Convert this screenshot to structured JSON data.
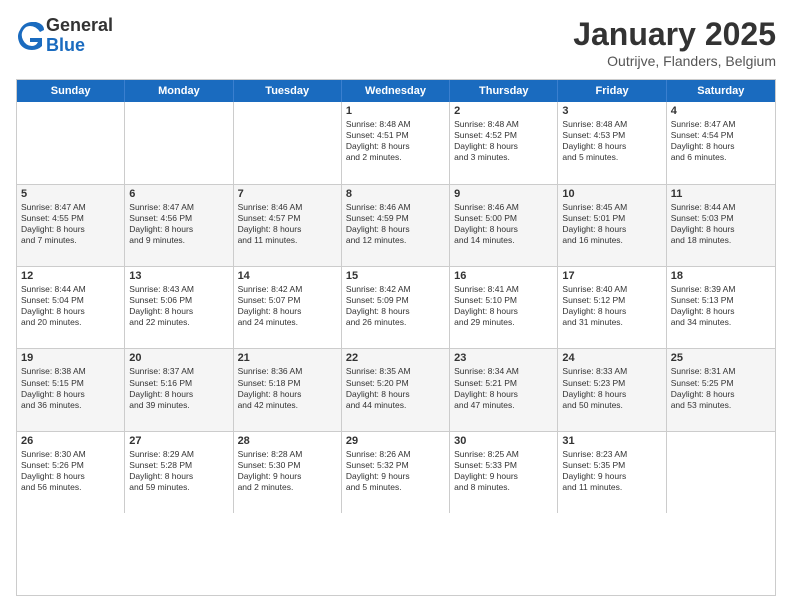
{
  "logo": {
    "general": "General",
    "blue": "Blue"
  },
  "title": "January 2025",
  "subtitle": "Outrijve, Flanders, Belgium",
  "headers": [
    "Sunday",
    "Monday",
    "Tuesday",
    "Wednesday",
    "Thursday",
    "Friday",
    "Saturday"
  ],
  "weeks": [
    [
      {
        "day": "",
        "lines": [],
        "shaded": false
      },
      {
        "day": "",
        "lines": [],
        "shaded": false
      },
      {
        "day": "",
        "lines": [],
        "shaded": false
      },
      {
        "day": "1",
        "lines": [
          "Sunrise: 8:48 AM",
          "Sunset: 4:51 PM",
          "Daylight: 8 hours",
          "and 2 minutes."
        ],
        "shaded": false
      },
      {
        "day": "2",
        "lines": [
          "Sunrise: 8:48 AM",
          "Sunset: 4:52 PM",
          "Daylight: 8 hours",
          "and 3 minutes."
        ],
        "shaded": false
      },
      {
        "day": "3",
        "lines": [
          "Sunrise: 8:48 AM",
          "Sunset: 4:53 PM",
          "Daylight: 8 hours",
          "and 5 minutes."
        ],
        "shaded": false
      },
      {
        "day": "4",
        "lines": [
          "Sunrise: 8:47 AM",
          "Sunset: 4:54 PM",
          "Daylight: 8 hours",
          "and 6 minutes."
        ],
        "shaded": false
      }
    ],
    [
      {
        "day": "5",
        "lines": [
          "Sunrise: 8:47 AM",
          "Sunset: 4:55 PM",
          "Daylight: 8 hours",
          "and 7 minutes."
        ],
        "shaded": true
      },
      {
        "day": "6",
        "lines": [
          "Sunrise: 8:47 AM",
          "Sunset: 4:56 PM",
          "Daylight: 8 hours",
          "and 9 minutes."
        ],
        "shaded": true
      },
      {
        "day": "7",
        "lines": [
          "Sunrise: 8:46 AM",
          "Sunset: 4:57 PM",
          "Daylight: 8 hours",
          "and 11 minutes."
        ],
        "shaded": true
      },
      {
        "day": "8",
        "lines": [
          "Sunrise: 8:46 AM",
          "Sunset: 4:59 PM",
          "Daylight: 8 hours",
          "and 12 minutes."
        ],
        "shaded": true
      },
      {
        "day": "9",
        "lines": [
          "Sunrise: 8:46 AM",
          "Sunset: 5:00 PM",
          "Daylight: 8 hours",
          "and 14 minutes."
        ],
        "shaded": true
      },
      {
        "day": "10",
        "lines": [
          "Sunrise: 8:45 AM",
          "Sunset: 5:01 PM",
          "Daylight: 8 hours",
          "and 16 minutes."
        ],
        "shaded": true
      },
      {
        "day": "11",
        "lines": [
          "Sunrise: 8:44 AM",
          "Sunset: 5:03 PM",
          "Daylight: 8 hours",
          "and 18 minutes."
        ],
        "shaded": true
      }
    ],
    [
      {
        "day": "12",
        "lines": [
          "Sunrise: 8:44 AM",
          "Sunset: 5:04 PM",
          "Daylight: 8 hours",
          "and 20 minutes."
        ],
        "shaded": false
      },
      {
        "day": "13",
        "lines": [
          "Sunrise: 8:43 AM",
          "Sunset: 5:06 PM",
          "Daylight: 8 hours",
          "and 22 minutes."
        ],
        "shaded": false
      },
      {
        "day": "14",
        "lines": [
          "Sunrise: 8:42 AM",
          "Sunset: 5:07 PM",
          "Daylight: 8 hours",
          "and 24 minutes."
        ],
        "shaded": false
      },
      {
        "day": "15",
        "lines": [
          "Sunrise: 8:42 AM",
          "Sunset: 5:09 PM",
          "Daylight: 8 hours",
          "and 26 minutes."
        ],
        "shaded": false
      },
      {
        "day": "16",
        "lines": [
          "Sunrise: 8:41 AM",
          "Sunset: 5:10 PM",
          "Daylight: 8 hours",
          "and 29 minutes."
        ],
        "shaded": false
      },
      {
        "day": "17",
        "lines": [
          "Sunrise: 8:40 AM",
          "Sunset: 5:12 PM",
          "Daylight: 8 hours",
          "and 31 minutes."
        ],
        "shaded": false
      },
      {
        "day": "18",
        "lines": [
          "Sunrise: 8:39 AM",
          "Sunset: 5:13 PM",
          "Daylight: 8 hours",
          "and 34 minutes."
        ],
        "shaded": false
      }
    ],
    [
      {
        "day": "19",
        "lines": [
          "Sunrise: 8:38 AM",
          "Sunset: 5:15 PM",
          "Daylight: 8 hours",
          "and 36 minutes."
        ],
        "shaded": true
      },
      {
        "day": "20",
        "lines": [
          "Sunrise: 8:37 AM",
          "Sunset: 5:16 PM",
          "Daylight: 8 hours",
          "and 39 minutes."
        ],
        "shaded": true
      },
      {
        "day": "21",
        "lines": [
          "Sunrise: 8:36 AM",
          "Sunset: 5:18 PM",
          "Daylight: 8 hours",
          "and 42 minutes."
        ],
        "shaded": true
      },
      {
        "day": "22",
        "lines": [
          "Sunrise: 8:35 AM",
          "Sunset: 5:20 PM",
          "Daylight: 8 hours",
          "and 44 minutes."
        ],
        "shaded": true
      },
      {
        "day": "23",
        "lines": [
          "Sunrise: 8:34 AM",
          "Sunset: 5:21 PM",
          "Daylight: 8 hours",
          "and 47 minutes."
        ],
        "shaded": true
      },
      {
        "day": "24",
        "lines": [
          "Sunrise: 8:33 AM",
          "Sunset: 5:23 PM",
          "Daylight: 8 hours",
          "and 50 minutes."
        ],
        "shaded": true
      },
      {
        "day": "25",
        "lines": [
          "Sunrise: 8:31 AM",
          "Sunset: 5:25 PM",
          "Daylight: 8 hours",
          "and 53 minutes."
        ],
        "shaded": true
      }
    ],
    [
      {
        "day": "26",
        "lines": [
          "Sunrise: 8:30 AM",
          "Sunset: 5:26 PM",
          "Daylight: 8 hours",
          "and 56 minutes."
        ],
        "shaded": false
      },
      {
        "day": "27",
        "lines": [
          "Sunrise: 8:29 AM",
          "Sunset: 5:28 PM",
          "Daylight: 8 hours",
          "and 59 minutes."
        ],
        "shaded": false
      },
      {
        "day": "28",
        "lines": [
          "Sunrise: 8:28 AM",
          "Sunset: 5:30 PM",
          "Daylight: 9 hours",
          "and 2 minutes."
        ],
        "shaded": false
      },
      {
        "day": "29",
        "lines": [
          "Sunrise: 8:26 AM",
          "Sunset: 5:32 PM",
          "Daylight: 9 hours",
          "and 5 minutes."
        ],
        "shaded": false
      },
      {
        "day": "30",
        "lines": [
          "Sunrise: 8:25 AM",
          "Sunset: 5:33 PM",
          "Daylight: 9 hours",
          "and 8 minutes."
        ],
        "shaded": false
      },
      {
        "day": "31",
        "lines": [
          "Sunrise: 8:23 AM",
          "Sunset: 5:35 PM",
          "Daylight: 9 hours",
          "and 11 minutes."
        ],
        "shaded": false
      },
      {
        "day": "",
        "lines": [],
        "shaded": false
      }
    ]
  ]
}
